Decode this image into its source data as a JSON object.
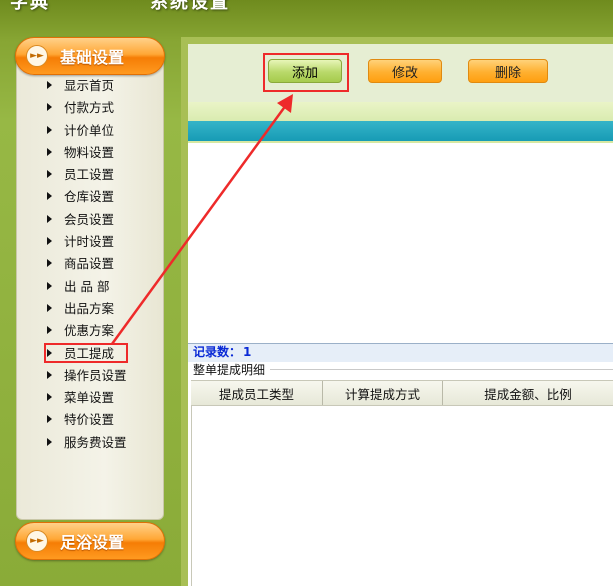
{
  "header": {
    "title_left": "字典",
    "title_right": "系统设置"
  },
  "sidebar": {
    "basic_section_label": "基础设置",
    "footer_section_label": "足浴设置",
    "items": [
      {
        "label": "显示首页"
      },
      {
        "label": "付款方式"
      },
      {
        "label": "计价单位"
      },
      {
        "label": "物料设置"
      },
      {
        "label": "员工设置"
      },
      {
        "label": "仓库设置"
      },
      {
        "label": "会员设置"
      },
      {
        "label": "计时设置"
      },
      {
        "label": "商品设置"
      },
      {
        "label": "出 品 部"
      },
      {
        "label": "出品方案"
      },
      {
        "label": "优惠方案"
      },
      {
        "label": "员工提成",
        "highlighted": true
      },
      {
        "label": "操作员设置"
      },
      {
        "label": "菜单设置"
      },
      {
        "label": "特价设置"
      },
      {
        "label": "服务费设置"
      }
    ]
  },
  "toolbar": {
    "add_label": "添加",
    "edit_label": "修改",
    "delete_label": "删除"
  },
  "records": {
    "label": "记录数：",
    "count": "1"
  },
  "detail": {
    "group_label": "整单提成明细",
    "columns": [
      "提成员工类型",
      "计算提成方式",
      "提成金额、比例"
    ]
  },
  "colors": {
    "annotation_red": "#ee2a2a",
    "accent_orange": "#ff9a20",
    "teal_bar": "#179bb5",
    "background_green": "#8aab38"
  }
}
